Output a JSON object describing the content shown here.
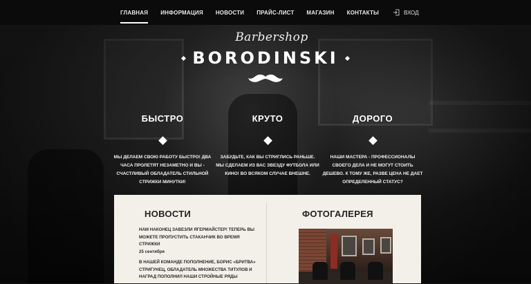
{
  "nav": {
    "items": [
      {
        "label": "ГЛАВНАЯ",
        "active": true
      },
      {
        "label": "ИНФОРМАЦИЯ",
        "active": false
      },
      {
        "label": "НОВОСТИ",
        "active": false
      },
      {
        "label": "ПРАЙС-ЛИСТ",
        "active": false
      },
      {
        "label": "МАГАЗИН",
        "active": false
      },
      {
        "label": "КОНТАКТЫ",
        "active": false
      }
    ],
    "login_label": "ВХОД",
    "login_icon": "login-icon"
  },
  "logo": {
    "script": "Barbershop",
    "name": "BORODINSKI",
    "emblem_icon": "mustache-icon"
  },
  "features": [
    {
      "title": "БЫСТРО",
      "text": "МЫ ДЕЛАЕМ СВОЮ РАБОТУ БЫСТРО! ДВА ЧАСА ПРОЛЕТЯТ НЕЗАМЕТНО И ВЫ - СЧАСТЛИВЫЙ ОБЛАДАТЕЛЬ СТИЛЬНОЙ СТРИЖКИ МИНУТКИ!"
    },
    {
      "title": "КРУТО",
      "text": "ЗАБУДЬТЕ, КАК ВЫ СТРИГЛИСЬ РАНЬШЕ. МЫ СДЕЛАЕМ ИЗ ВАС ЗВЕЗДУ ФУТБОЛА ИЛИ КИНО! ВО ВСЯКОМ СЛУЧАЕ ВНЕШНЕ."
    },
    {
      "title": "ДОРОГО",
      "text": "НАШИ МАСТЕРА - ПРОФЕССИОНАЛЫ СВОЕГО ДЕЛА И НЕ МОГУТ СТОИТЬ ДЕШЕВО. К ТОМУ ЖЕ, РАЗВЕ ЦЕНА НЕ ДАЕТ ОПРЕДЕЛЕННЫЙ СТАТУС?"
    }
  ],
  "news": {
    "title": "НОВОСТИ",
    "items": [
      {
        "text": "НАМ НАКОНЕЦ ЗАВЕЗЛИ ЯГЕРМАЙСТЕР! ТЕПЕРЬ ВЫ МОЖЕТЕ ПРОПУСТИТЬ СТАКАНЧИК ВО ВРЕМЯ СТРИЖКИ",
        "date": "25 сентября"
      },
      {
        "text": "В НАШЕЙ КОМАНДЕ ПОПОЛНЕНИЕ, БОРИС «БРИТВА» СТРИГУНЕЦ, ОБЛАДАТЕЛЬ МНОЖЕСТВА ТИТУЛОВ И НАГРАД ПОПОЛНИЛ НАШИ СТРОЙНЫЕ РЯДЫ",
        "date": ""
      }
    ]
  },
  "gallery": {
    "title": "ФОТОГАЛЕРЕЯ"
  },
  "colors": {
    "nav_bg": "#0b0b0b",
    "panel_bg": "#f3f0ea",
    "text_dark": "#222222",
    "text_light": "#ffffff"
  }
}
